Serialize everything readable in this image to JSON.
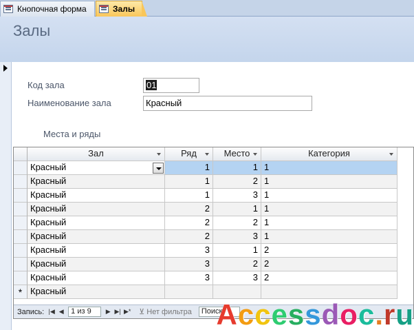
{
  "tabs": [
    {
      "label": "Кнопочная форма"
    },
    {
      "label": "Залы"
    }
  ],
  "form": {
    "title": "Залы",
    "code_label": "Код зала",
    "code_value": "01",
    "name_label": "Наименование зала",
    "name_value": "Красный",
    "subform_label": "Места и ряды"
  },
  "grid": {
    "headers": [
      "Зал",
      "Ряд",
      "Место",
      "Категория"
    ],
    "rows": [
      {
        "hall": "Красный",
        "row": "1",
        "seat": "1",
        "cat": "1"
      },
      {
        "hall": "Красный",
        "row": "1",
        "seat": "2",
        "cat": "1"
      },
      {
        "hall": "Красный",
        "row": "1",
        "seat": "3",
        "cat": "1"
      },
      {
        "hall": "Красный",
        "row": "2",
        "seat": "1",
        "cat": "1"
      },
      {
        "hall": "Красный",
        "row": "2",
        "seat": "2",
        "cat": "1"
      },
      {
        "hall": "Красный",
        "row": "2",
        "seat": "3",
        "cat": "1"
      },
      {
        "hall": "Красный",
        "row": "3",
        "seat": "1",
        "cat": "2"
      },
      {
        "hall": "Красный",
        "row": "3",
        "seat": "2",
        "cat": "2"
      },
      {
        "hall": "Красный",
        "row": "3",
        "seat": "3",
        "cat": "2"
      }
    ],
    "new_row_hall": "Красный",
    "new_row_marker": "*"
  },
  "navbar": {
    "record_label": "Запись:",
    "position": "1 из 9",
    "filter": "Нет фильтра",
    "search": "Поиск"
  },
  "watermark": "Accessdoc.ru",
  "colors": {
    "accent_tab": "#f9c65a",
    "header_bg": "#c4d5ec",
    "current_row": "#b4d3f2"
  }
}
